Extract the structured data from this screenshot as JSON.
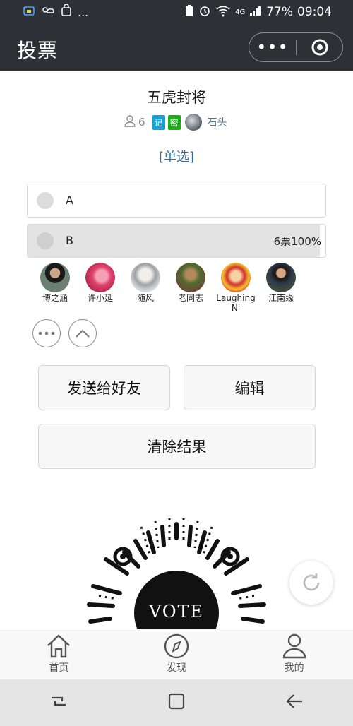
{
  "status_bar": {
    "signal_label": "4G",
    "battery": "77%",
    "time": "09:04",
    "overflow": "..."
  },
  "header": {
    "title": "投票",
    "more_label": "•••"
  },
  "poll": {
    "title": "五虎封将",
    "participant_count": "6",
    "tags": [
      "记",
      "密"
    ],
    "creator_name": "石头",
    "type_label": "[单选]",
    "options": [
      {
        "label": "A",
        "votes_text": "",
        "percent": 0
      },
      {
        "label": "B",
        "votes_text": "6票",
        "percent_text": "100%",
        "percent": 100
      }
    ],
    "voters": [
      {
        "name": "博之涵",
        "color": "#6b7f72"
      },
      {
        "name": "许小延",
        "color": "#e0426b"
      },
      {
        "name": "随风",
        "color": "#b9bdc1"
      },
      {
        "name": "老同志",
        "color": "#6b4d34"
      },
      {
        "name": "Laughing Ni",
        "color": "#d3322b"
      },
      {
        "name": "江南缘",
        "color": "#3d4a3c"
      }
    ]
  },
  "actions": {
    "send_friend": "发送给好友",
    "edit": "编辑",
    "clear_results": "清除结果"
  },
  "qr": {
    "center_text": "VOTE"
  },
  "tabbar": {
    "items": [
      {
        "label": "首页",
        "icon": "home-icon"
      },
      {
        "label": "发现",
        "icon": "compass-icon"
      },
      {
        "label": "我的",
        "icon": "person-icon"
      }
    ]
  }
}
